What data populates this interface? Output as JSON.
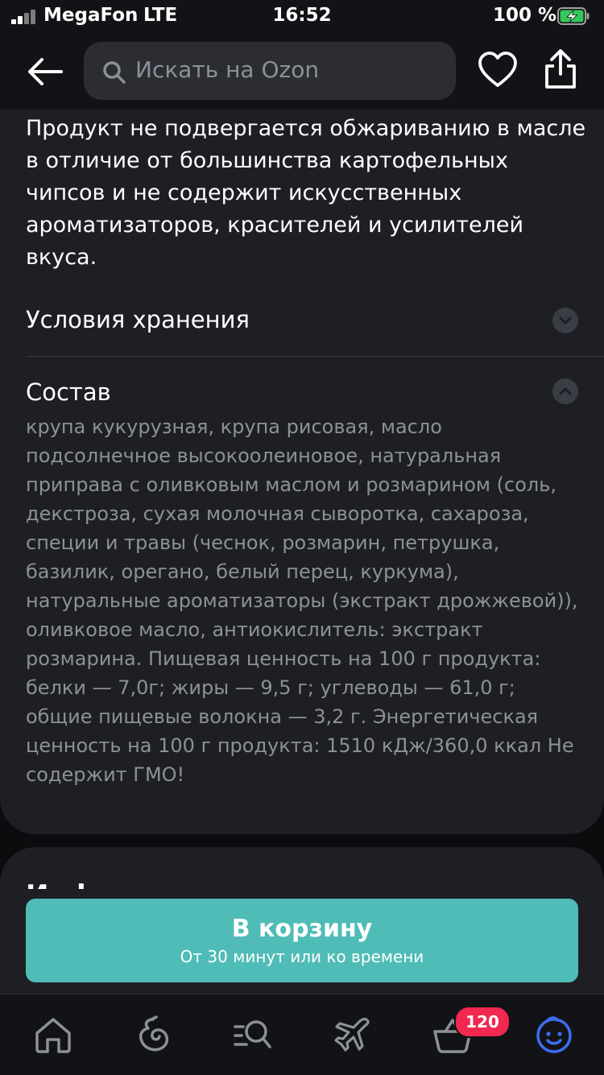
{
  "status_bar": {
    "carrier": "MegaFon",
    "network": "LTE",
    "time": "16:52",
    "battery": "100 %"
  },
  "header": {
    "search_placeholder": "Искать на Ozon",
    "icons": [
      "back-arrow-icon",
      "search-icon",
      "heart-icon",
      "share-icon"
    ]
  },
  "description": {
    "text": "Продукт не подвергается обжариванию в масле в отличие от большинства картофельных чипсов и не содержит искусственных ароматизаторов, красителей и усилителей вкуса."
  },
  "sections": [
    {
      "title": "Условия хранения",
      "expanded": false
    },
    {
      "title": "Состав",
      "expanded": true,
      "body": "крупа кукурузная, крупа рисовая, масло подсолнечное высокоолеиновое, натуральная приправа с оливковым маслом и розмарином (соль, декстроза, сухая молочная сыворотка, сахароза, специи и травы (чеснок, розмарин, петрушка, базилик, орегано, белый перец, куркума), натуральные ароматизаторы (экстракт дрожжевой)), оливковое масло, антиокислитель: экстракт розмарина. Пищевая ценность на 100 г продукта: белки — 7,0г; жиры — 9,5 г; углеводы — 61,0 г; общие пищевые волокна — 3,2 г. Энергетическая ценность на 100 г продукта: 1510 кДж/360,0 ккал Не содержит ГМО!"
    }
  ],
  "next_section_heading": "Информация",
  "cart_button": {
    "label": "В корзину",
    "sublabel": "От 30 минут или ко времени"
  },
  "tab_bar": {
    "tabs": [
      "home-icon",
      "fresh-icon",
      "catalog-search-icon",
      "travel-icon",
      "cart-icon",
      "profile-icon"
    ],
    "cart_badge": "120"
  },
  "colors": {
    "background": "#1d1f24",
    "accent_button": "#50bcb7",
    "badge": "#f1284f",
    "muted_text": "#8d9097",
    "profile_icon": "#3e6cf0"
  }
}
